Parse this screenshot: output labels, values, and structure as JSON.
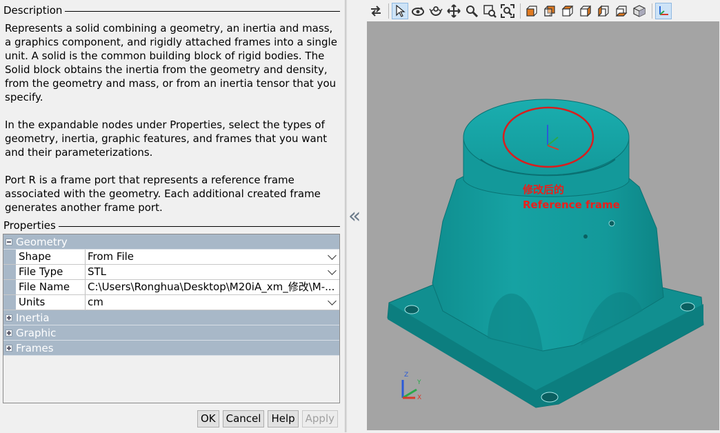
{
  "description": {
    "title": "Description",
    "paragraphs": [
      "Represents a solid combining a geometry, an inertia and mass, a graphics component, and rigidly attached frames into a single unit. A solid is the common building block of rigid bodies. The Solid block obtains the inertia from the geometry and density, from the geometry and mass, or from an inertia tensor that you specify.",
      "In the expandable nodes under Properties, select the types of geometry, inertia, graphic features, and frames that you want and their parameterizations.",
      "Port R is a frame port that represents a reference frame associated with the geometry. Each additional created frame generates another frame port."
    ]
  },
  "properties": {
    "title": "Properties",
    "geometry": {
      "label": "Geometry",
      "rows": [
        {
          "key": "Shape",
          "value": "From File"
        },
        {
          "key": "File Type",
          "value": "STL"
        },
        {
          "key": "File Name",
          "value": "C:\\Users\\Ronghua\\Desktop\\M20iA_xm_修改\\M-..."
        },
        {
          "key": "Units",
          "value": "cm"
        }
      ]
    },
    "inertia": {
      "label": "Inertia"
    },
    "graphic": {
      "label": "Graphic"
    },
    "frames": {
      "label": "Frames"
    }
  },
  "buttons": {
    "ok": "OK",
    "cancel": "Cancel",
    "help": "Help",
    "apply": "Apply"
  },
  "viewer": {
    "collapse_glyph": "«",
    "annotation_line1": "修改后的",
    "annotation_line2": "Reference frame",
    "axis_labels": {
      "x": "X",
      "y": "Y",
      "z": "Z"
    },
    "model_color": "#13999a",
    "background_color": "#a4a4a4",
    "annotation_color": "#e8201c"
  },
  "toolbar": {
    "icons": [
      "swap-icon",
      "select-pointer-icon",
      "rotate-icon",
      "roll-icon",
      "pan-icon",
      "zoom-icon",
      "box-zoom-icon",
      "fit-view-icon",
      "view-front-icon",
      "view-back-icon",
      "view-left-icon",
      "view-right-icon",
      "view-top-icon",
      "view-bottom-icon",
      "view-iso-icon",
      "frame-toggle-icon"
    ]
  }
}
